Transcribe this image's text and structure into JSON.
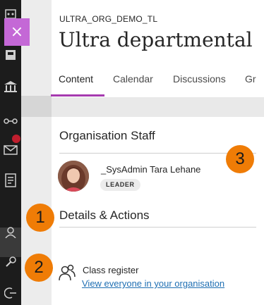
{
  "left_rail": {
    "icons": [
      "grid-icon",
      "profile-icon",
      "institution-icon",
      "tools-icon",
      "messages-icon",
      "grades-icon",
      "user-icon",
      "tools-2-icon",
      "signout-icon"
    ]
  },
  "panel": {
    "close_label": "×",
    "org_id": "ULTRA_ORG_DEMO_TL",
    "title": "Ultra departmental",
    "tabs": [
      {
        "label": "Content",
        "active": true
      },
      {
        "label": "Calendar",
        "active": false
      },
      {
        "label": "Discussions",
        "active": false
      },
      {
        "label": "Gr",
        "active": false
      }
    ],
    "staff": {
      "heading": "Organisation Staff",
      "name": "_SysAdmin Tara Lehane",
      "role": "LEADER"
    },
    "details": {
      "heading": "Details & Actions",
      "register_label": "Class register",
      "register_link": "View everyone in your organisation"
    }
  },
  "callouts": [
    "1",
    "2",
    "3"
  ],
  "colors": {
    "accent": "#a63aaf",
    "close_button": "#c468d6",
    "callout": "#ef7c06",
    "link": "#1f6fb3",
    "rail": "#1c1c1c"
  }
}
